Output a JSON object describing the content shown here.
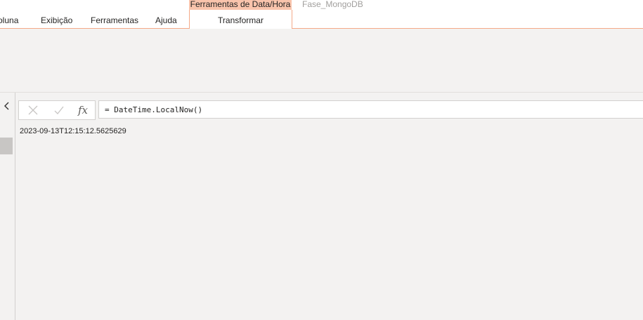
{
  "ribbon": {
    "tabs": [
      {
        "label": "oluna"
      },
      {
        "label": "Exibição"
      },
      {
        "label": "Ferramentas"
      },
      {
        "label": "Ajuda"
      }
    ],
    "contextual_group": "Ferramentas de Data/Hora",
    "contextual_tab": "Transformar"
  },
  "document_title": "Fase_MongoDB",
  "formula_bar": {
    "fx_label": "fx",
    "formula": "= DateTime.LocalNow()"
  },
  "result": {
    "value": "2023-09-13T12:15:12.5625629"
  },
  "colors": {
    "accent": "#f4a988",
    "contextual_header": "#f9c4ac",
    "background": "#f3f2f1"
  },
  "icons": {
    "collapse": "chevron-left-icon",
    "cancel": "close-icon",
    "commit": "check-icon",
    "function": "fx-icon"
  }
}
